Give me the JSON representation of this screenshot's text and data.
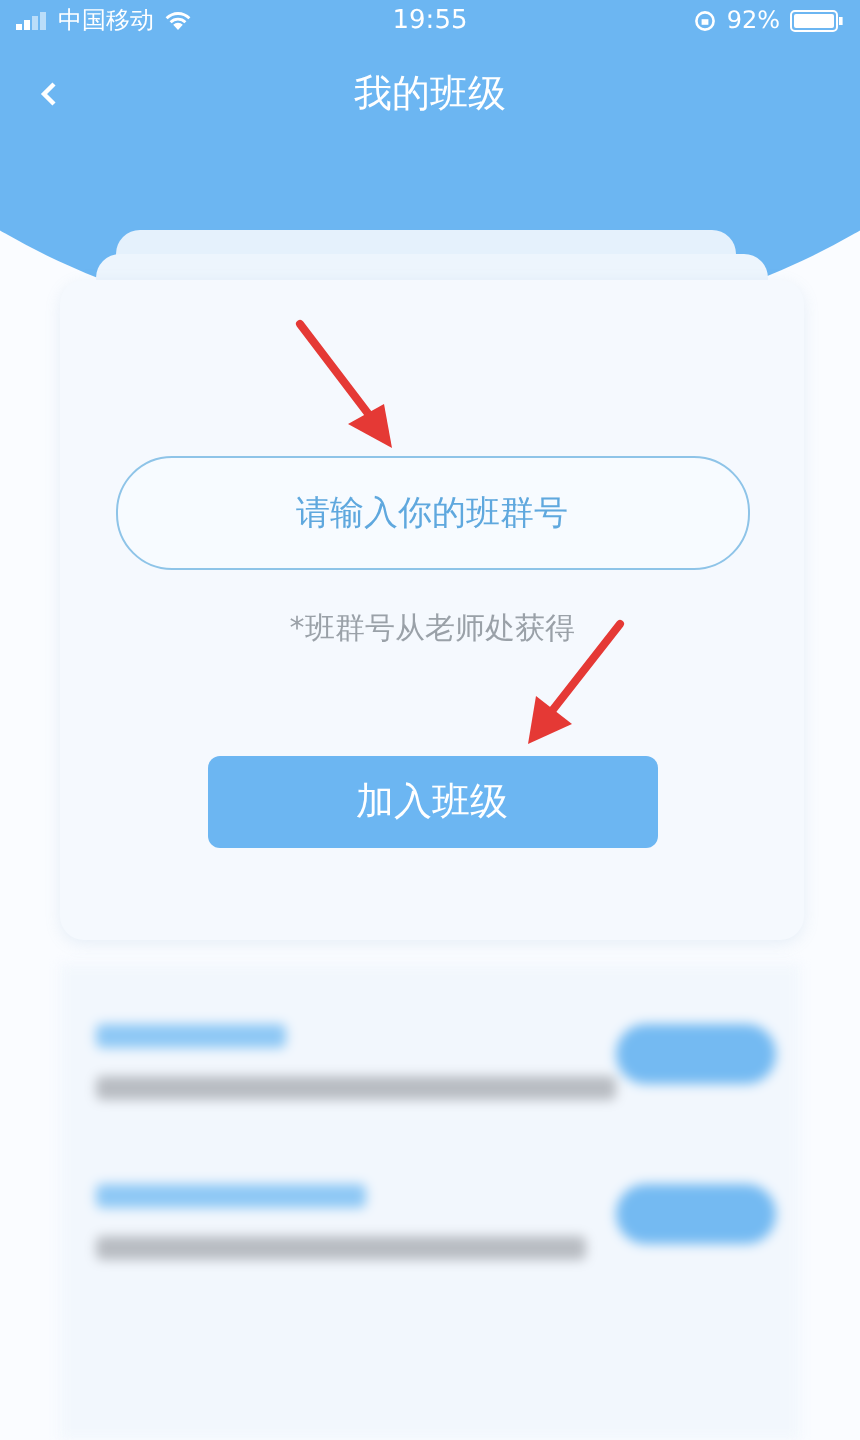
{
  "status_bar": {
    "carrier": "中国移动",
    "time": "19:55",
    "battery": "92%"
  },
  "header": {
    "title": "我的班级"
  },
  "join_form": {
    "placeholder": "请输入你的班群号",
    "hint": "*班群号从老师处获得",
    "button": "加入班级"
  }
}
